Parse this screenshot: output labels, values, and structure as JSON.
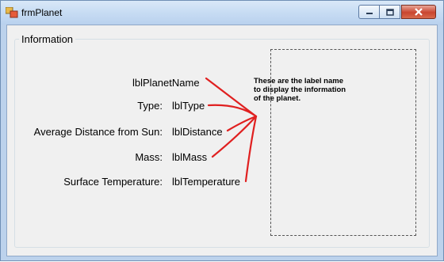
{
  "window": {
    "title": "frmPlanet",
    "icon": "app-form-icon",
    "controls": [
      "minimize-icon",
      "maximize-icon",
      "close-icon"
    ]
  },
  "groupbox": {
    "title": "Information"
  },
  "fields": {
    "planet_name": "lblPlanetName",
    "type_caption": "Type:",
    "type_value": "lblType",
    "distance_caption": "Average Distance from Sun:",
    "distance_value": "lblDistance",
    "mass_caption": "Mass:",
    "mass_value": "lblMass",
    "temperature_caption": "Surface Temperature:",
    "temperature_value": "lblTemperature"
  },
  "annotation": {
    "line1": "These are the label name",
    "line2": "to display the information",
    "line3": "of the planet.",
    "arrow_color": "#e02020"
  },
  "colors": {
    "titlebar": "#c7dcf3",
    "client_background": "#f0f0f0",
    "close_button": "#c9452f"
  }
}
